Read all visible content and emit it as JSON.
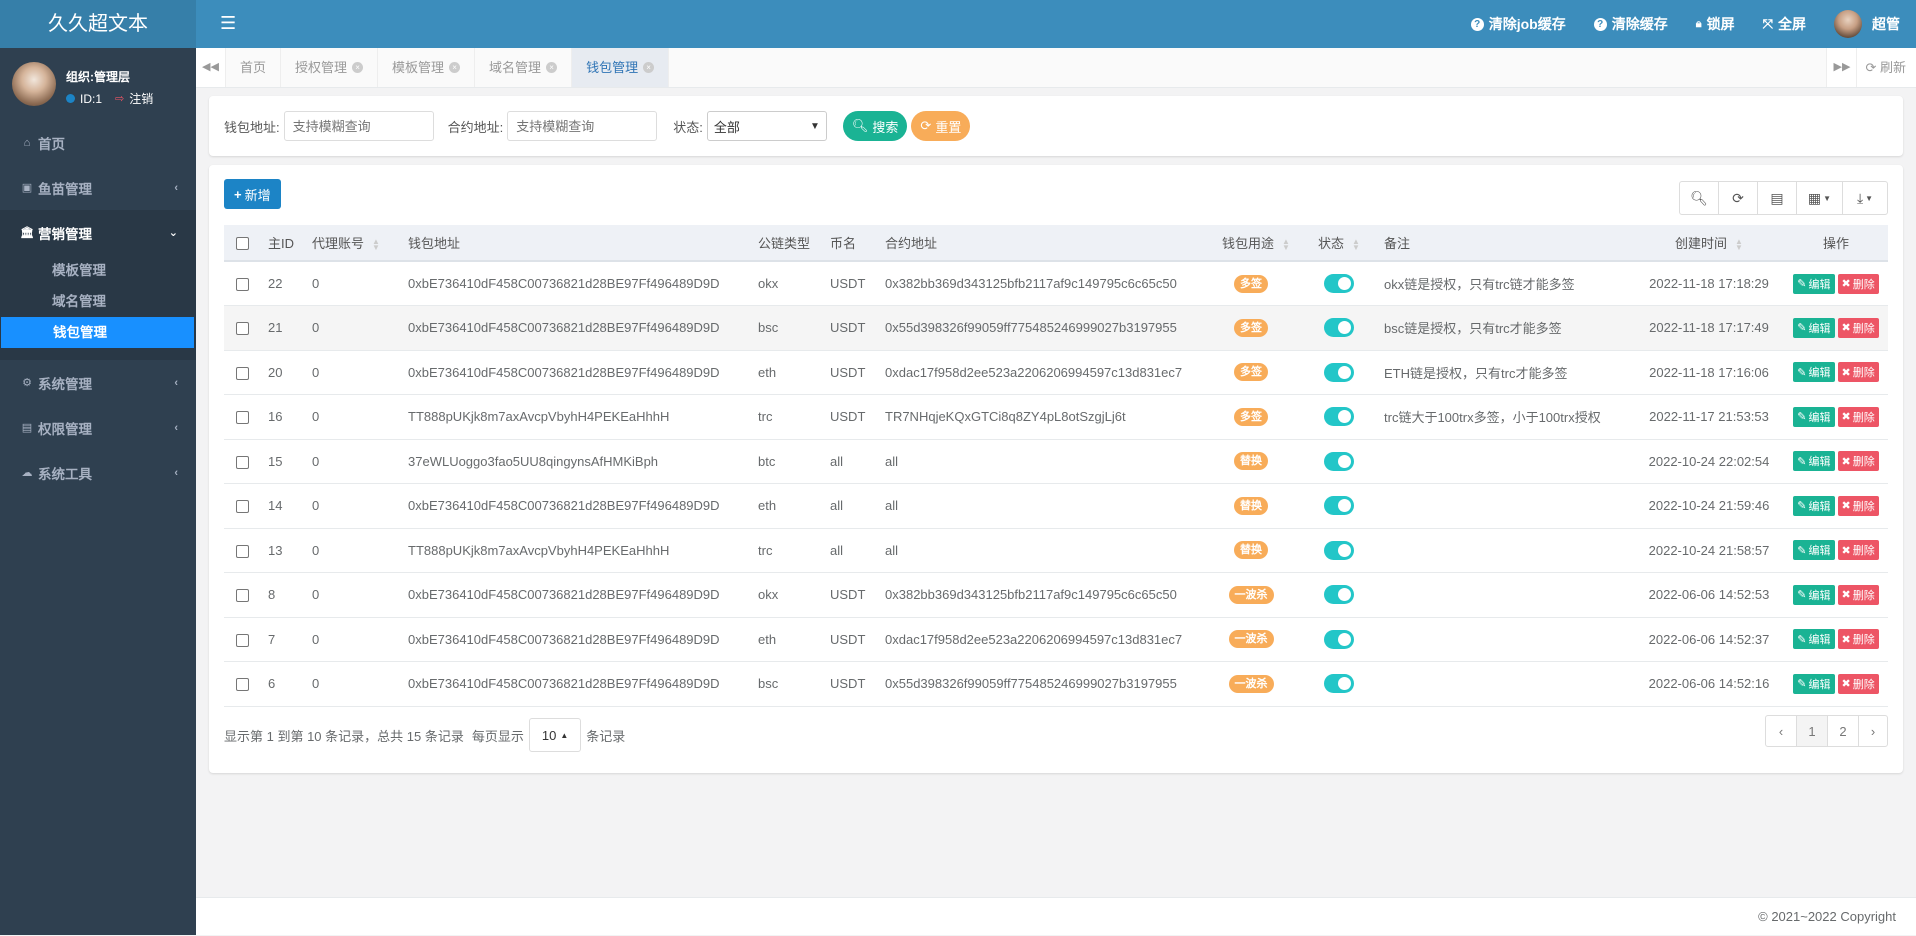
{
  "app": {
    "title": "久久超文本"
  },
  "header": {
    "actions": [
      {
        "icon": "question-circle-icon",
        "label": "清除job缓存"
      },
      {
        "icon": "question-circle-icon",
        "label": "清除缓存"
      },
      {
        "icon": "lock-icon",
        "label": "锁屏"
      },
      {
        "icon": "expand-icon",
        "label": "全屏"
      }
    ],
    "user_name": "超管"
  },
  "sidebar": {
    "org": "组织:管理层",
    "user_id": "ID:1",
    "logout": "注销",
    "items": [
      {
        "icon": "home-icon",
        "label": "首页"
      },
      {
        "icon": "money-icon",
        "label": "鱼苗管理"
      },
      {
        "icon": "bank-icon",
        "label": "营销管理",
        "children": [
          "模板管理",
          "域名管理",
          "钱包管理"
        ]
      },
      {
        "icon": "gear-icon",
        "label": "系统管理"
      },
      {
        "icon": "id-card-icon",
        "label": "权限管理"
      },
      {
        "icon": "cloud-icon",
        "label": "系统工具"
      }
    ]
  },
  "tabs": {
    "items": [
      "首页",
      "授权管理",
      "模板管理",
      "域名管理",
      "钱包管理"
    ],
    "active": "钱包管理",
    "refresh": "刷新"
  },
  "search": {
    "wallet_label": "钱包地址:",
    "wallet_placeholder": "支持模糊查询",
    "contract_label": "合约地址:",
    "contract_placeholder": "支持模糊查询",
    "status_label": "状态:",
    "status_value": "全部",
    "search_btn": "搜索",
    "reset_btn": "重置"
  },
  "table": {
    "add_btn": "新增",
    "columns": [
      "主ID",
      "代理账号",
      "钱包地址",
      "公链类型",
      "币名",
      "合约地址",
      "钱包用途",
      "状态",
      "备注",
      "创建时间",
      "操作"
    ],
    "edit_label": "编辑",
    "delete_label": "删除",
    "rows": [
      {
        "id": "22",
        "agent": "0",
        "wallet": "0xbE736410dF458C00736821d28BE97Ff496489D9D",
        "chain": "okx",
        "coin": "USDT",
        "contract": "0x382bb369d343125bfb2117af9c149795c6c65c50",
        "usage": "多签",
        "status": true,
        "remark": "okx链是授权，只有trc链才能多签",
        "created": "2022-11-18 17:18:29"
      },
      {
        "id": "21",
        "agent": "0",
        "wallet": "0xbE736410dF458C00736821d28BE97Ff496489D9D",
        "chain": "bsc",
        "coin": "USDT",
        "contract": "0x55d398326f99059ff775485246999027b3197955",
        "usage": "多签",
        "status": true,
        "remark": "bsc链是授权，只有trc才能多签",
        "created": "2022-11-18 17:17:49"
      },
      {
        "id": "20",
        "agent": "0",
        "wallet": "0xbE736410dF458C00736821d28BE97Ff496489D9D",
        "chain": "eth",
        "coin": "USDT",
        "contract": "0xdac17f958d2ee523a2206206994597c13d831ec7",
        "usage": "多签",
        "status": true,
        "remark": "ETH链是授权，只有trc才能多签",
        "created": "2022-11-18 17:16:06"
      },
      {
        "id": "16",
        "agent": "0",
        "wallet": "TT888pUKjk8m7axAvcpVbyhH4PEKEaHhhH",
        "chain": "trc",
        "coin": "USDT",
        "contract": "TR7NHqjeKQxGTCi8q8ZY4pL8otSzgjLj6t",
        "usage": "多签",
        "status": true,
        "remark": "trc链大于100trx多签，小于100trx授权",
        "created": "2022-11-17 21:53:53"
      },
      {
        "id": "15",
        "agent": "0",
        "wallet": "37eWLUoggo3fao5UU8qingynsAfHMKiBph",
        "chain": "btc",
        "coin": "all",
        "contract": "all",
        "usage": "替换",
        "status": true,
        "remark": "",
        "created": "2022-10-24 22:02:54"
      },
      {
        "id": "14",
        "agent": "0",
        "wallet": "0xbE736410dF458C00736821d28BE97Ff496489D9D",
        "chain": "eth",
        "coin": "all",
        "contract": "all",
        "usage": "替换",
        "status": true,
        "remark": "",
        "created": "2022-10-24 21:59:46"
      },
      {
        "id": "13",
        "agent": "0",
        "wallet": "TT888pUKjk8m7axAvcpVbyhH4PEKEaHhhH",
        "chain": "trc",
        "coin": "all",
        "contract": "all",
        "usage": "替换",
        "status": true,
        "remark": "",
        "created": "2022-10-24 21:58:57"
      },
      {
        "id": "8",
        "agent": "0",
        "wallet": "0xbE736410dF458C00736821d28BE97Ff496489D9D",
        "chain": "okx",
        "coin": "USDT",
        "contract": "0x382bb369d343125bfb2117af9c149795c6c65c50",
        "usage": "一波杀",
        "status": true,
        "remark": "",
        "created": "2022-06-06 14:52:53"
      },
      {
        "id": "7",
        "agent": "0",
        "wallet": "0xbE736410dF458C00736821d28BE97Ff496489D9D",
        "chain": "eth",
        "coin": "USDT",
        "contract": "0xdac17f958d2ee523a2206206994597c13d831ec7",
        "usage": "一波杀",
        "status": true,
        "remark": "",
        "created": "2022-06-06 14:52:37"
      },
      {
        "id": "6",
        "agent": "0",
        "wallet": "0xbE736410dF458C00736821d28BE97Ff496489D9D",
        "chain": "bsc",
        "coin": "USDT",
        "contract": "0x55d398326f99059ff775485246999027b3197955",
        "usage": "一波杀",
        "status": true,
        "remark": "",
        "created": "2022-06-06 14:52:16"
      }
    ]
  },
  "pager": {
    "summary": "显示第 1 到第 10 条记录，总共 15 条记录",
    "per_page_prefix": "每页显示",
    "per_page": "10",
    "per_page_suffix": "条记录",
    "prev": "‹",
    "pages": [
      "1",
      "2"
    ],
    "current": "1",
    "next": "›"
  },
  "footer": {
    "copyright": "© 2021~2022 Copyright"
  },
  "colors": {
    "header": "#3c8dbc",
    "sidebar": "#2f4050",
    "active": "#1890ff",
    "primary": "#1c84c6",
    "success": "#1ab394",
    "warning": "#f8ac59",
    "danger": "#ed5565",
    "switch": "#23c6c8"
  }
}
